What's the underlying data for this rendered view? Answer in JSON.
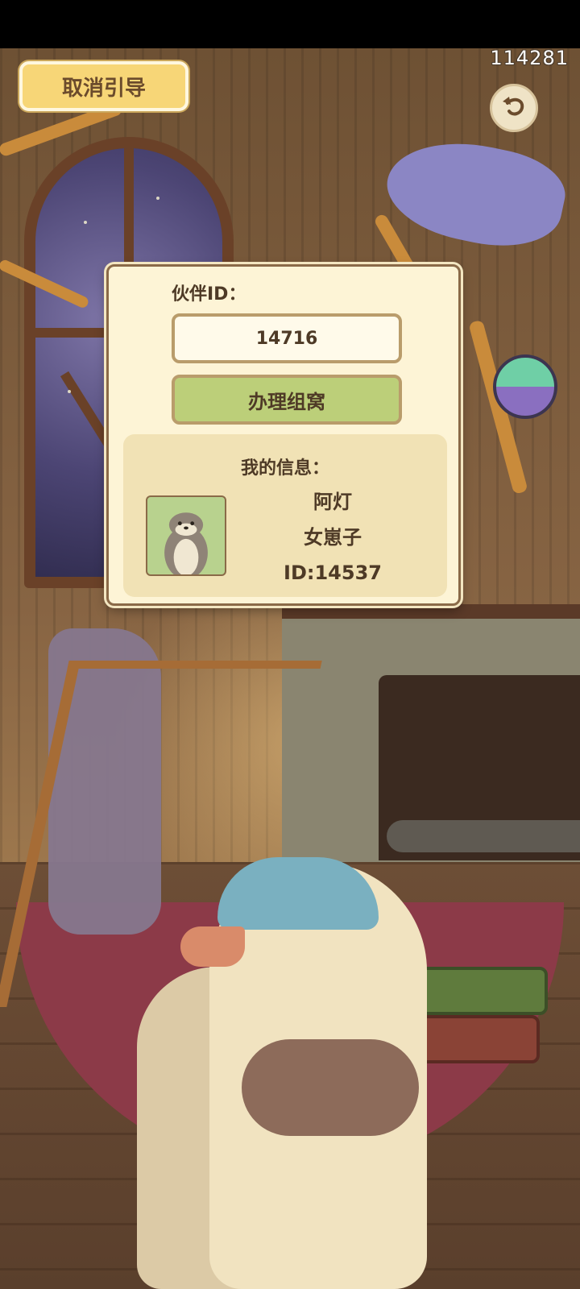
{
  "top_bar": {
    "counter": "114281",
    "cancel_guide_label": "取消引导",
    "back_icon": "curved-arrow-back-icon"
  },
  "dialog": {
    "partner_id_label": "伙伴ID：",
    "partner_id_value": "14716",
    "apply_button_label": "办理组窝",
    "my_info": {
      "title": "我的信息：",
      "name": "阿灯",
      "relation": "女崽子",
      "id_text": "ID:14537"
    }
  },
  "colors": {
    "cancel_button_bg": "#f7d677",
    "apply_button_bg": "#bccf79",
    "dialog_bg": "#fdf4d6",
    "text_brown": "#4e3a26"
  }
}
